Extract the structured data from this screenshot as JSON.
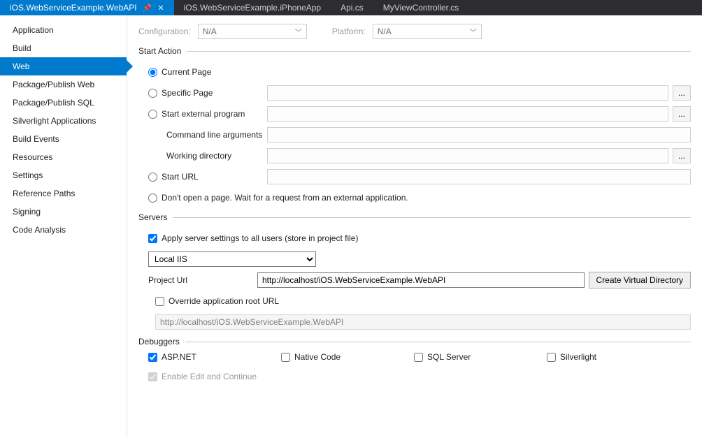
{
  "tabs": [
    {
      "label": "iOS.WebServiceExample.WebAPI",
      "active": true,
      "pinned": true
    },
    {
      "label": "iOS.WebServiceExample.iPhoneApp"
    },
    {
      "label": "Api.cs"
    },
    {
      "label": "MyViewController.cs"
    }
  ],
  "sidebar": {
    "items": [
      "Application",
      "Build",
      "Web",
      "Package/Publish Web",
      "Package/Publish SQL",
      "Silverlight Applications",
      "Build Events",
      "Resources",
      "Settings",
      "Reference Paths",
      "Signing",
      "Code Analysis"
    ],
    "selected_index": 2
  },
  "top": {
    "configuration_label": "Configuration:",
    "configuration_value": "N/A",
    "platform_label": "Platform:",
    "platform_value": "N/A"
  },
  "start_action": {
    "title": "Start Action",
    "options": {
      "current_page": "Current Page",
      "specific_page": "Specific Page",
      "start_external": "Start external program",
      "command_line_args": "Command line arguments",
      "working_directory": "Working directory",
      "start_url": "Start URL",
      "dont_open": "Don't open a page.  Wait for a request from an external application."
    },
    "values": {
      "specific_page": "",
      "start_external": "",
      "command_line_args": "",
      "working_directory": "",
      "start_url": ""
    },
    "selected": "current_page",
    "ellipsis": "..."
  },
  "servers": {
    "title": "Servers",
    "apply_settings_label": "Apply server settings to all users (store in project file)",
    "apply_settings_checked": true,
    "server_type": "Local IIS",
    "project_url_label": "Project Url",
    "project_url_value": "http://localhost/iOS.WebServiceExample.WebAPI",
    "create_vdir_label": "Create Virtual Directory",
    "override_root_label": "Override application root URL",
    "override_root_checked": false,
    "override_root_value": "http://localhost/iOS.WebServiceExample.WebAPI"
  },
  "debuggers": {
    "title": "Debuggers",
    "items": [
      {
        "label": "ASP.NET",
        "checked": true
      },
      {
        "label": "Native Code",
        "checked": false
      },
      {
        "label": "SQL Server",
        "checked": false
      },
      {
        "label": "Silverlight",
        "checked": false
      }
    ],
    "enable_edit_label": "Enable Edit and Continue",
    "enable_edit_checked": true
  }
}
